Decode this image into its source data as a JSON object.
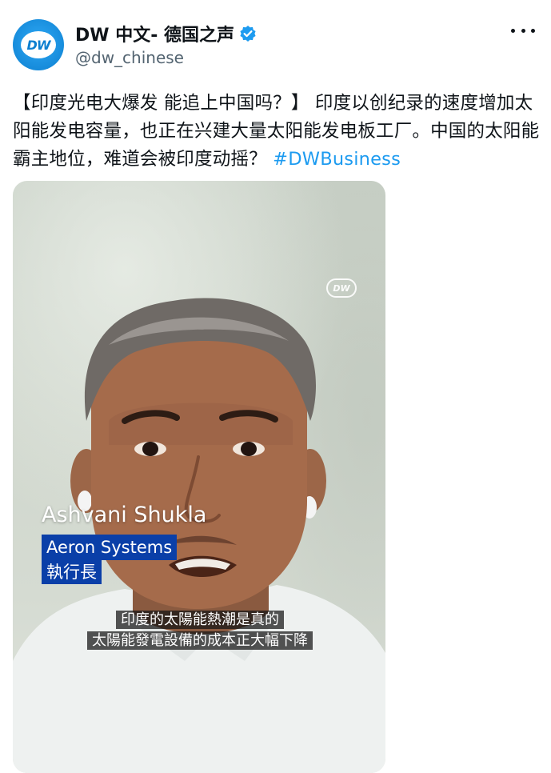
{
  "author": {
    "display_name": "DW 中文- 德国之声",
    "handle": "@dw_chinese",
    "avatar_text": "DW",
    "verified": true
  },
  "post": {
    "text": "【印度光电大爆发 能追上中国吗？】 印度以创纪录的速度增加太阳能发电容量，也正在兴建大量太阳能发电板工厂。中国的太阳能霸主地位，难道会被印度动摇？",
    "hashtag": "#DWBusiness"
  },
  "video": {
    "watermark": "DW",
    "speaker_name": "Ashvani Shukla",
    "speaker_org": "Aeron Systems",
    "speaker_title": "執行長",
    "subtitle_line1": "印度的太陽能熱潮是真的",
    "subtitle_line2": "太陽能發電設備的成本正大幅下降"
  },
  "colors": {
    "accent": "#1d9bf0",
    "lower_third_bg": "#0a3fa8",
    "text": "#0f1419",
    "muted": "#536471"
  },
  "icons": {
    "verified": "verified-badge-icon",
    "more": "more-options-icon",
    "avatar": "dw-logo-icon"
  }
}
